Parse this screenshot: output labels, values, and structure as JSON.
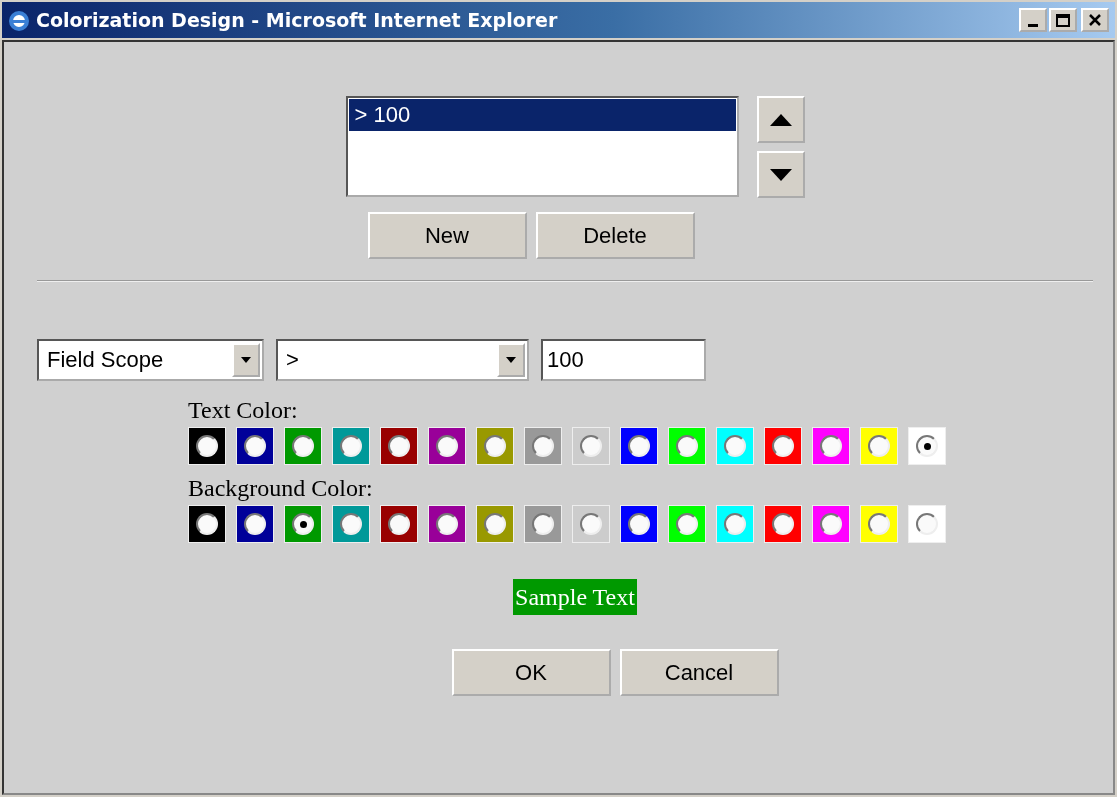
{
  "window": {
    "title": "Colorization Design - Microsoft Internet Explorer"
  },
  "rules": [
    {
      "label": "> 100",
      "selected": true
    }
  ],
  "list_buttons": [
    "New",
    "Delete"
  ],
  "condition": {
    "scope": "Field Scope",
    "operator": ">",
    "value": "100"
  },
  "text_color": {
    "label": "Text Color:",
    "swatches": [
      {
        "color": "#000000",
        "selected": false
      },
      {
        "color": "#000099",
        "selected": false
      },
      {
        "color": "#009900",
        "selected": false
      },
      {
        "color": "#009999",
        "selected": false
      },
      {
        "color": "#990000",
        "selected": false
      },
      {
        "color": "#990099",
        "selected": false
      },
      {
        "color": "#999900",
        "selected": false
      },
      {
        "color": "#999999",
        "selected": false
      },
      {
        "color": "#cccccc",
        "selected": false
      },
      {
        "color": "#0000ff",
        "selected": false
      },
      {
        "color": "#00ff00",
        "selected": false
      },
      {
        "color": "#00ffff",
        "selected": false
      },
      {
        "color": "#ff0000",
        "selected": false
      },
      {
        "color": "#ff00ff",
        "selected": false
      },
      {
        "color": "#ffff00",
        "selected": false
      },
      {
        "color": "#ffffff",
        "selected": true
      }
    ]
  },
  "background_color": {
    "label": "Background Color:",
    "swatches": [
      {
        "color": "#000000",
        "selected": false
      },
      {
        "color": "#000099",
        "selected": false
      },
      {
        "color": "#009900",
        "selected": true
      },
      {
        "color": "#009999",
        "selected": false
      },
      {
        "color": "#990000",
        "selected": false
      },
      {
        "color": "#990099",
        "selected": false
      },
      {
        "color": "#999900",
        "selected": false
      },
      {
        "color": "#999999",
        "selected": false
      },
      {
        "color": "#cccccc",
        "selected": false
      },
      {
        "color": "#0000ff",
        "selected": false
      },
      {
        "color": "#00ff00",
        "selected": false
      },
      {
        "color": "#00ffff",
        "selected": false
      },
      {
        "color": "#ff0000",
        "selected": false
      },
      {
        "color": "#ff00ff",
        "selected": false
      },
      {
        "color": "#ffff00",
        "selected": false
      },
      {
        "color": "#ffffff",
        "selected": false
      }
    ]
  },
  "sample": "Sample Text",
  "dialog_buttons": [
    "OK",
    "Cancel"
  ]
}
